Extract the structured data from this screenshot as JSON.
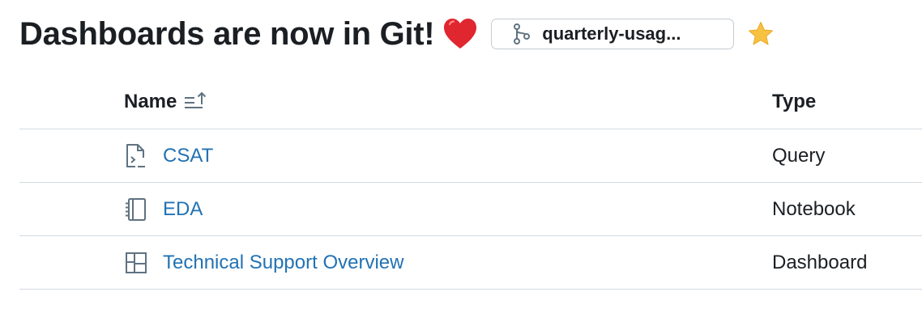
{
  "header": {
    "title": "Dashboards are now in Git!",
    "heart_icon": "heart-icon",
    "branch": {
      "label": "quarterly-usag...",
      "icon": "git-branch-icon"
    },
    "star_icon": "star-icon"
  },
  "table": {
    "columns": {
      "name": "Name",
      "type": "Type"
    },
    "sort_icon": "sort-ascending-icon",
    "rows": [
      {
        "name": "CSAT",
        "type": "Query",
        "icon": "query-file-icon"
      },
      {
        "name": "EDA",
        "type": "Notebook",
        "icon": "notebook-icon"
      },
      {
        "name": "Technical Support Overview",
        "type": "Dashboard",
        "icon": "dashboard-icon"
      }
    ]
  },
  "colors": {
    "link": "#2272b4",
    "text": "#1b1f23",
    "border": "#d3dae0",
    "icon": "#5f7281",
    "heart": "#e0262f",
    "star": "#f7c242"
  }
}
